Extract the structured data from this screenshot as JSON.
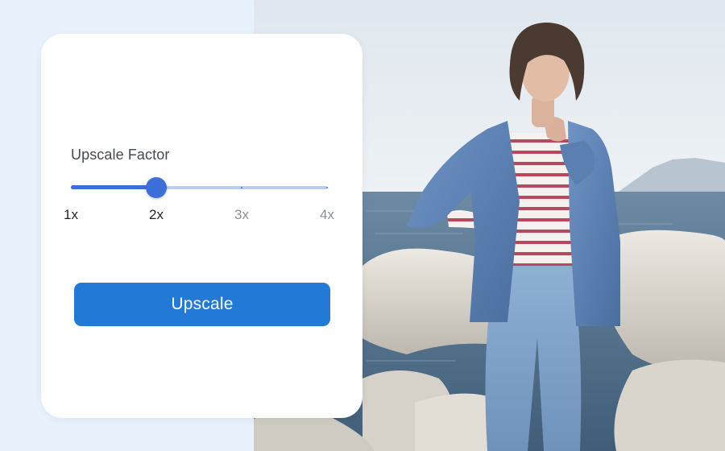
{
  "panel": {
    "label": "Upscale Factor",
    "slider": {
      "options": [
        "1x",
        "2x",
        "3x",
        "4x"
      ],
      "selected_index": 1,
      "value_fraction": 0.333
    },
    "button_label": "Upscale"
  },
  "colors": {
    "page_background": "#e8f2fd",
    "accent": "#3b6fd8",
    "track_inactive": "#b9cdf0",
    "button": "#2379d6",
    "button_text": "#ffffff"
  }
}
